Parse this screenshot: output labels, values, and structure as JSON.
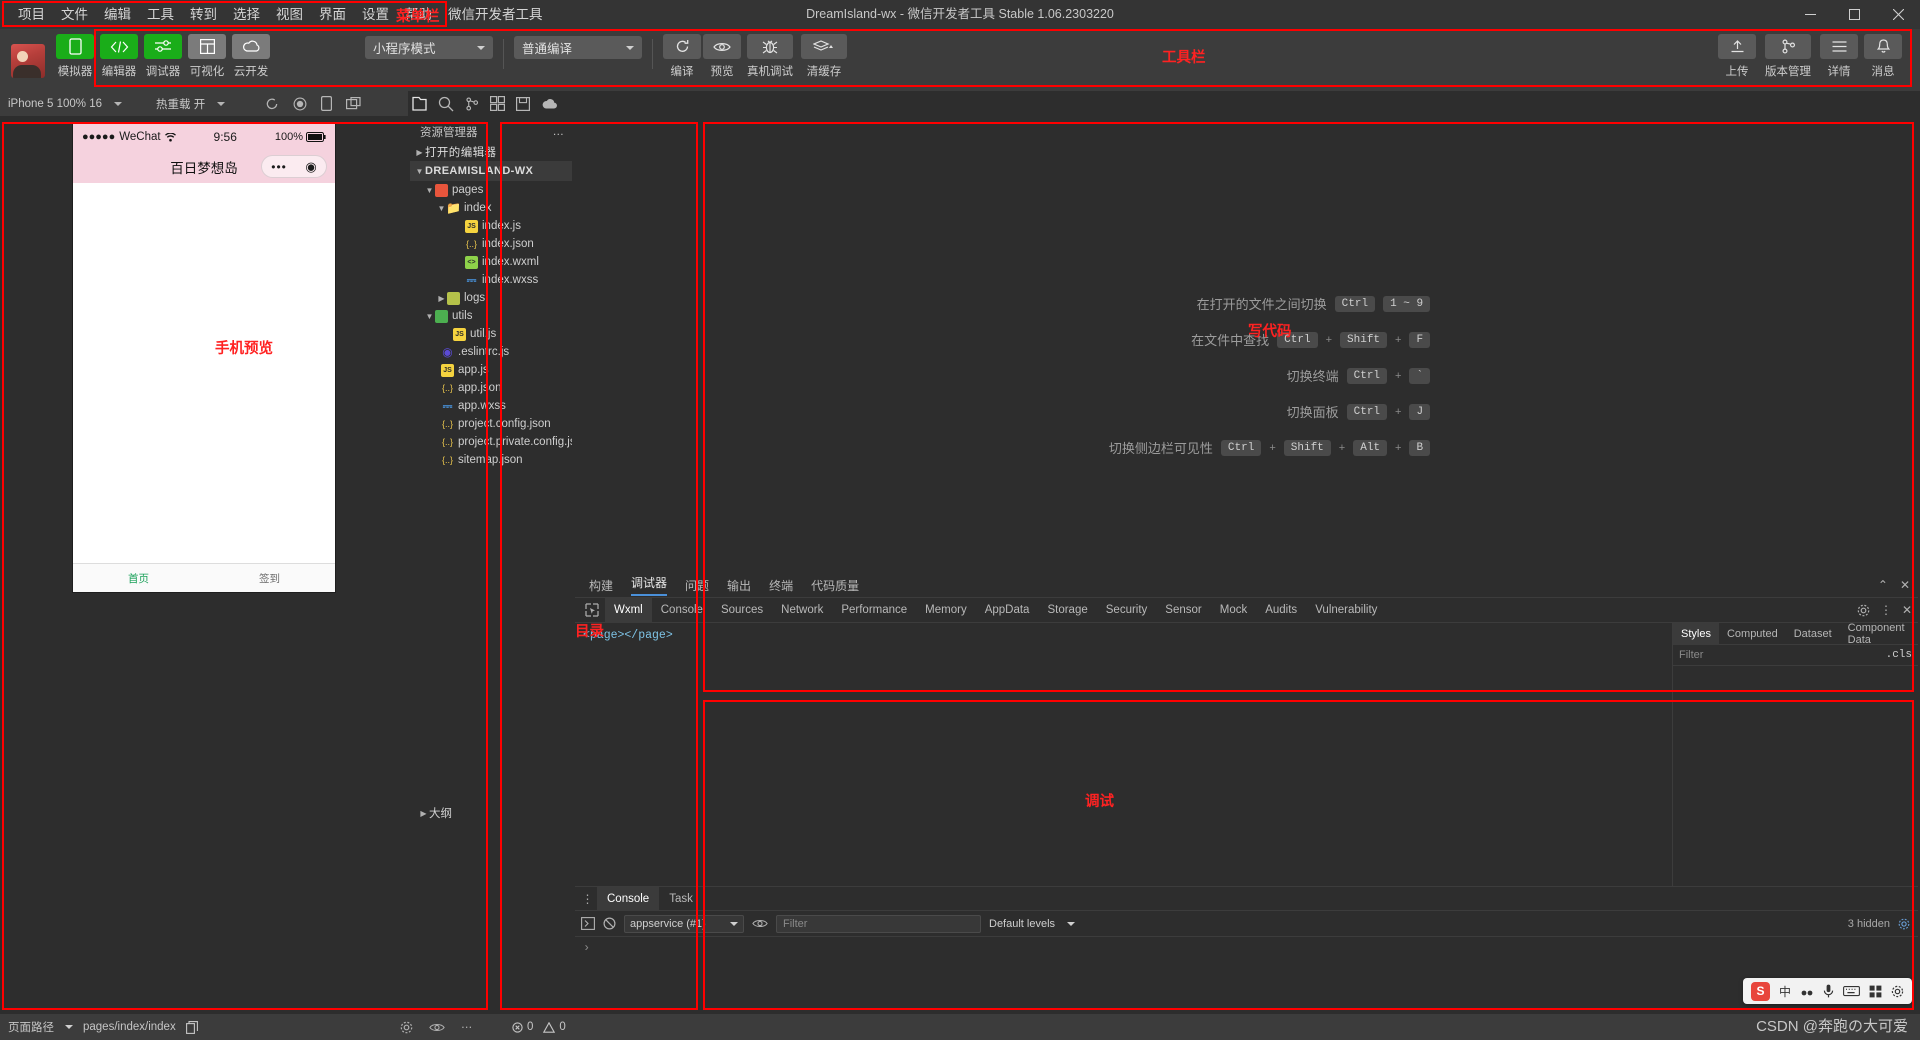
{
  "window": {
    "title": "DreamIsland-wx - 微信开发者工具 Stable 1.06.2303220",
    "minimize": "–",
    "maximize": "❐",
    "close": "✕"
  },
  "menubar": {
    "items": [
      "项目",
      "文件",
      "编辑",
      "工具",
      "转到",
      "选择",
      "视图",
      "界面",
      "设置",
      "帮助",
      "微信开发者工具"
    ]
  },
  "annotations": [
    {
      "label": "菜单栏"
    },
    {
      "label": "工具栏"
    },
    {
      "label": "手机预览"
    },
    {
      "label": "目录"
    },
    {
      "label": "写代码"
    },
    {
      "label": "调试"
    },
    {
      "label": "大纲"
    }
  ],
  "toolbar": {
    "mode_buttons": [
      {
        "label": "模拟器",
        "icon": "phone-icon",
        "style": "green"
      },
      {
        "label": "编辑器",
        "icon": "code-icon",
        "style": "green"
      },
      {
        "label": "调试器",
        "icon": "sliders-icon",
        "style": "green"
      },
      {
        "label": "可视化",
        "icon": "layout-icon",
        "style": "grey"
      },
      {
        "label": "云开发",
        "icon": "cloud-icon",
        "style": "grey"
      }
    ],
    "mode_select": "小程序模式",
    "compile_select": "普通编译",
    "action_buttons": [
      {
        "label": "编译",
        "icon": "refresh-icon"
      },
      {
        "label": "预览",
        "icon": "eye-icon"
      },
      {
        "label": "真机调试",
        "icon": "bug-icon"
      },
      {
        "label": "清缓存",
        "icon": "layers-icon"
      }
    ],
    "right_buttons": [
      {
        "label": "上传",
        "icon": "upload-icon"
      },
      {
        "label": "版本管理",
        "icon": "branch-icon"
      },
      {
        "label": "详情",
        "icon": "menu-icon"
      },
      {
        "label": "消息",
        "icon": "bell-icon"
      }
    ]
  },
  "simulator": {
    "device": "iPhone 5 100% 16",
    "hotreload": "热重载 开",
    "phone": {
      "carrier": "WeChat",
      "signal_dots": "●●●●●",
      "wifi_icon": "wifi-icon",
      "time": "9:56",
      "battery": "100%",
      "nav_title": "百日梦想岛",
      "capsule_more": "•••",
      "capsule_target": "◉",
      "tabbar": [
        {
          "label": "首页",
          "active": true
        },
        {
          "label": "签到",
          "active": false
        }
      ]
    }
  },
  "explorer": {
    "header": "资源管理器",
    "more": "…",
    "sections": [
      {
        "label": "打开的编辑器",
        "expanded": false,
        "kind": "section"
      },
      {
        "label": "DREAMISLAND-WX",
        "expanded": true,
        "kind": "root"
      }
    ],
    "tree": [
      {
        "label": "pages",
        "depth": 1,
        "kind": "folder-pages",
        "expanded": true
      },
      {
        "label": "index",
        "depth": 2,
        "kind": "folder-plain",
        "expanded": true
      },
      {
        "label": "index.js",
        "depth": 3,
        "kind": "js"
      },
      {
        "label": "index.json",
        "depth": 3,
        "kind": "json"
      },
      {
        "label": "index.wxml",
        "depth": 3,
        "kind": "wxml"
      },
      {
        "label": "index.wxss",
        "depth": 3,
        "kind": "wxss"
      },
      {
        "label": "logs",
        "depth": 2,
        "kind": "folder-logs",
        "expanded": false
      },
      {
        "label": "utils",
        "depth": 1,
        "kind": "folder-utils",
        "expanded": true
      },
      {
        "label": "util.js",
        "depth": 2,
        "kind": "js"
      },
      {
        "label": ".eslintrc.js",
        "depth": 1,
        "kind": "eslint"
      },
      {
        "label": "app.js",
        "depth": 1,
        "kind": "js"
      },
      {
        "label": "app.json",
        "depth": 1,
        "kind": "json"
      },
      {
        "label": "app.wxss",
        "depth": 1,
        "kind": "wxss"
      },
      {
        "label": "project.config.json",
        "depth": 1,
        "kind": "json"
      },
      {
        "label": "project.private.config.js…",
        "depth": 1,
        "kind": "json"
      },
      {
        "label": "sitemap.json",
        "depth": 1,
        "kind": "json"
      }
    ],
    "outline": "大纲"
  },
  "editor": {
    "shortcuts": [
      {
        "text": "在打开的文件之间切换",
        "keys": [
          "Ctrl",
          "1 ~ 9"
        ],
        "seps": [
          ""
        ]
      },
      {
        "text": "在文件中查找",
        "keys": [
          "Ctrl",
          "Shift",
          "F"
        ],
        "seps": [
          "+",
          "+"
        ]
      },
      {
        "text": "切换终端",
        "keys": [
          "Ctrl",
          "`"
        ],
        "seps": [
          "+"
        ]
      },
      {
        "text": "切换面板",
        "keys": [
          "Ctrl",
          "J"
        ],
        "seps": [
          "+"
        ]
      },
      {
        "text": "切换侧边栏可见性",
        "keys": [
          "Ctrl",
          "Shift",
          "Alt",
          "B"
        ],
        "seps": [
          "+",
          "+",
          "+"
        ]
      }
    ]
  },
  "debugger": {
    "panel_tabs": [
      {
        "label": "构建",
        "active": false
      },
      {
        "label": "调试器",
        "active": true
      },
      {
        "label": "问题",
        "active": false
      },
      {
        "label": "输出",
        "active": false
      },
      {
        "label": "终端",
        "active": false
      },
      {
        "label": "代码质量",
        "active": false
      }
    ],
    "panel_controls": [
      "⌃",
      "✕"
    ],
    "devtools_tabs": [
      {
        "label": "Wxml",
        "active": true
      },
      {
        "label": "Console",
        "active": false
      },
      {
        "label": "Sources",
        "active": false
      },
      {
        "label": "Network",
        "active": false
      },
      {
        "label": "Performance",
        "active": false
      },
      {
        "label": "Memory",
        "active": false
      },
      {
        "label": "AppData",
        "active": false
      },
      {
        "label": "Storage",
        "active": false
      },
      {
        "label": "Security",
        "active": false
      },
      {
        "label": "Sensor",
        "active": false
      },
      {
        "label": "Mock",
        "active": false
      },
      {
        "label": "Audits",
        "active": false
      },
      {
        "label": "Vulnerability",
        "active": false
      }
    ],
    "devtools_right": [
      "gear-icon",
      "kebab-icon",
      "close-icon"
    ],
    "dom_content": "<page></page>",
    "sidebar_tabs": [
      {
        "label": "Styles",
        "active": true
      },
      {
        "label": "Computed",
        "active": false
      },
      {
        "label": "Dataset",
        "active": false
      },
      {
        "label": "Component Data",
        "active": false
      }
    ],
    "sidebar_filter_placeholder": "Filter",
    "sidebar_cls": ".cls",
    "drawer_tabs": [
      {
        "label": "Console",
        "active": true
      },
      {
        "label": "Task",
        "active": false
      }
    ],
    "console": {
      "context": "appservice (#1)",
      "filter_placeholder": "Filter",
      "levels": "Default levels",
      "hidden": "3 hidden",
      "prompt": "›"
    }
  },
  "statusbar": {
    "path_label": "页面路径",
    "path_value": "pages/index/index",
    "copy_icon": "copy-icon",
    "mid_icons": [
      "gear-icon",
      "eye-icon",
      "ellipsis-icon"
    ],
    "errors": "0",
    "warnings": "0"
  },
  "ime": {
    "brand": "S",
    "items": [
      "中",
      "●●",
      "🎤",
      "⌨",
      "▦",
      "⚙"
    ]
  },
  "watermark": "CSDN @奔跑の大可爱"
}
